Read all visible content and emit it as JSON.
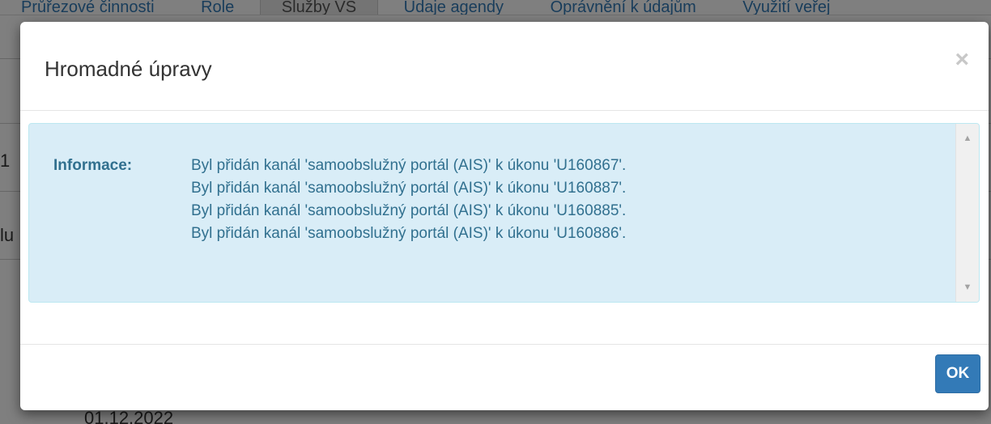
{
  "background": {
    "tabs": [
      "Průřezové činnosti",
      "Role",
      "Služby VS",
      "Údaje agendy",
      "Oprávnění k údajům",
      "Využití veřej"
    ],
    "active_tab_index": 2,
    "date": "01.12.2022",
    "edge_chars": [
      "1",
      "lu"
    ]
  },
  "modal": {
    "title": "Hromadné úpravy",
    "close_symbol": "×",
    "alert": {
      "label": "Informace:",
      "messages": [
        "Byl přidán kanál 'samoobslužný portál (AIS)' k úkonu 'U160867'.",
        "Byl přidán kanál 'samoobslužný portál (AIS)' k úkonu 'U160887'.",
        "Byl přidán kanál 'samoobslužný portál (AIS)' k úkonu 'U160885'.",
        "Byl přidán kanál 'samoobslužný portál (AIS)' k úkonu 'U160886'."
      ],
      "scroll_up_icon": "▲",
      "scroll_down_icon": "▼"
    },
    "ok_label": "OK"
  },
  "colors": {
    "alert_bg": "#d9edf7",
    "alert_text": "#31708f",
    "primary": "#337ab7"
  }
}
